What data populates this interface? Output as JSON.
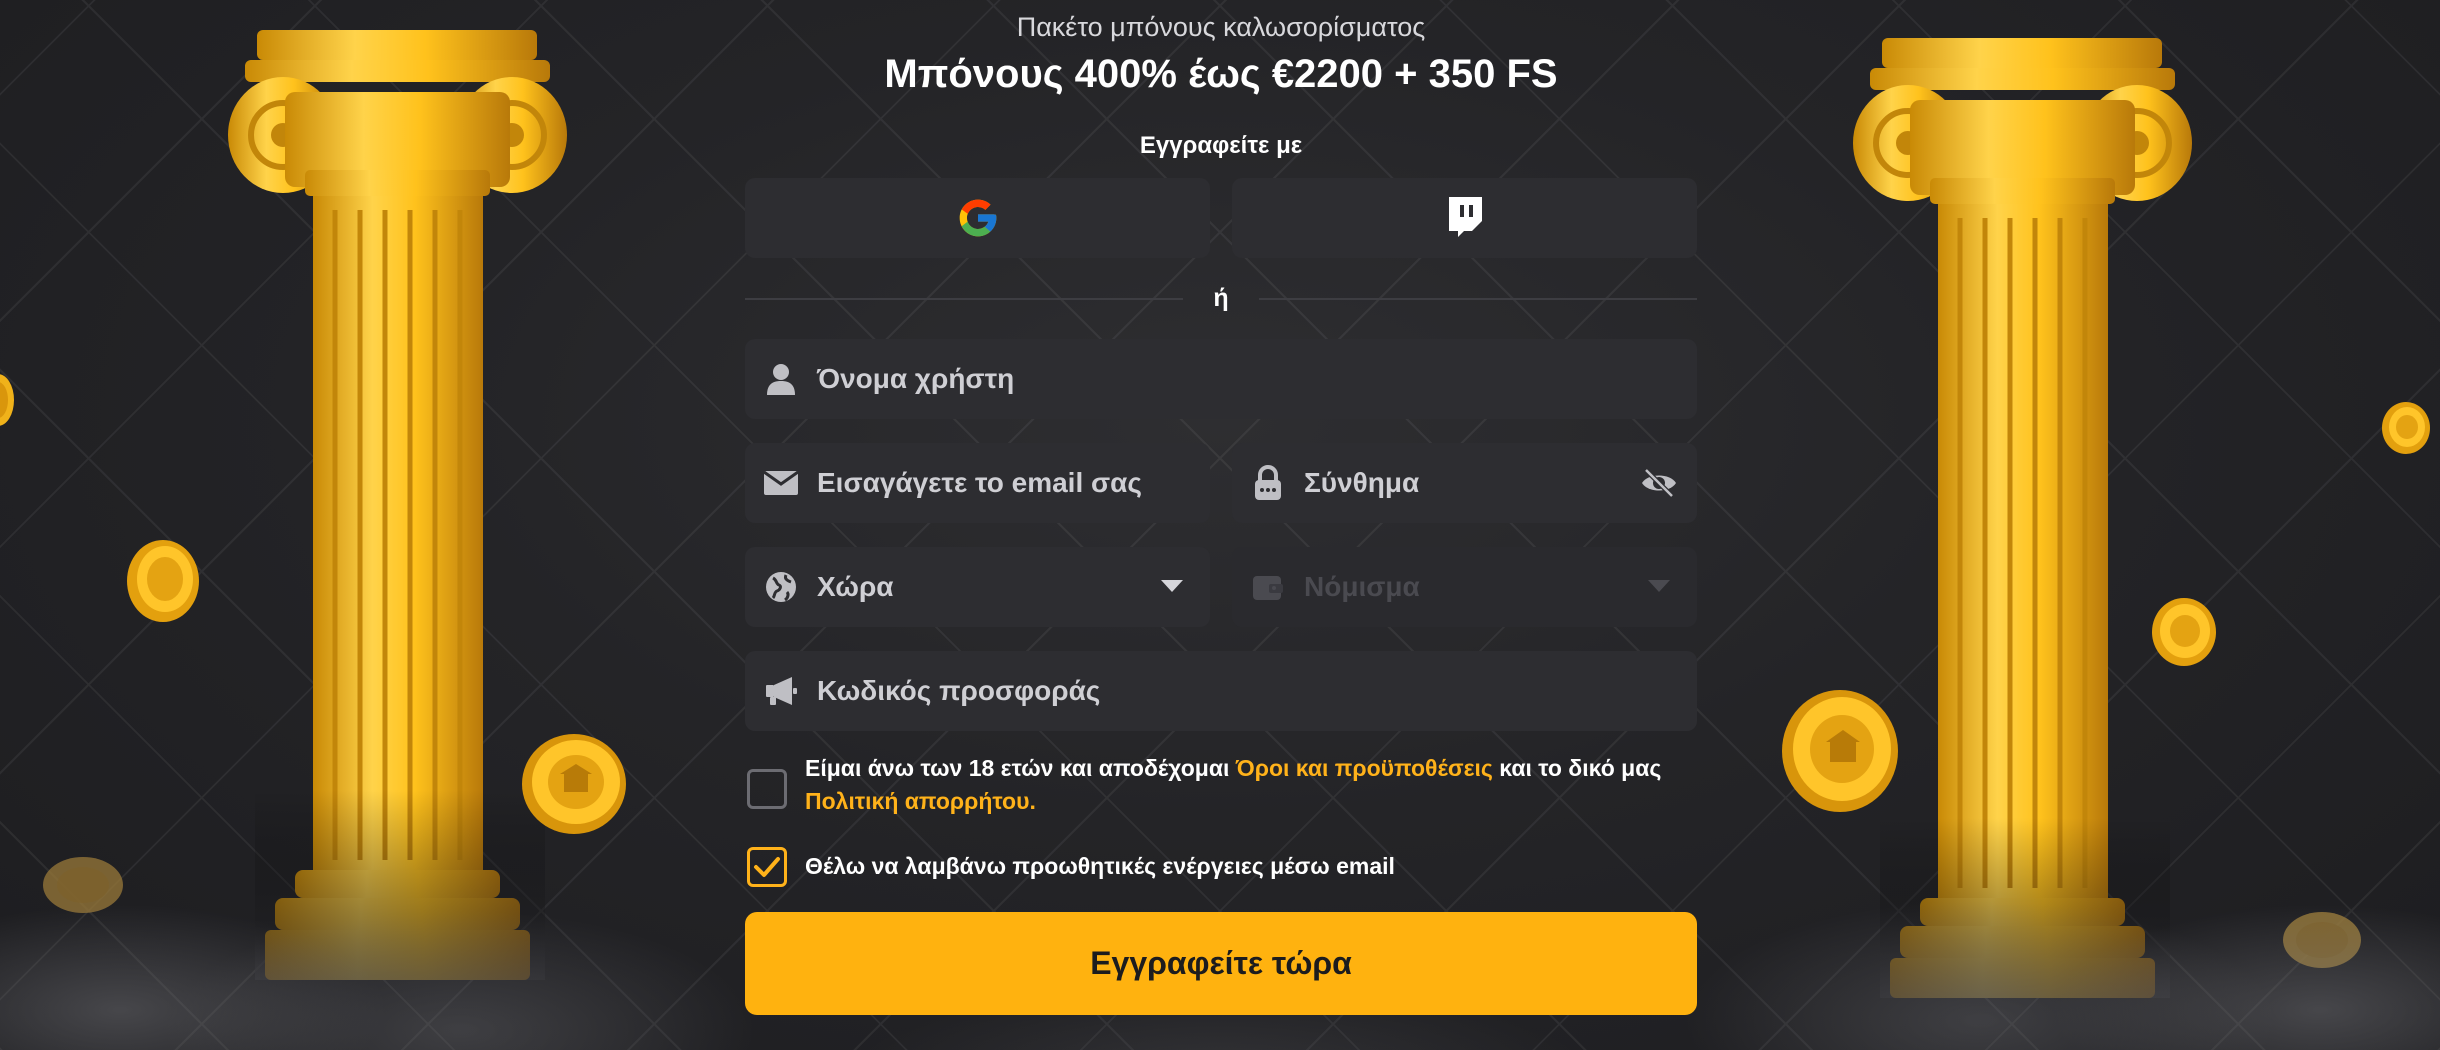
{
  "header": {
    "subtitle": "Πακέτο μπόνους καλωσορίσματος",
    "title": "Μπόνους 400% έως €2200 + 350 FS"
  },
  "social": {
    "heading": "Εγγραφείτε με",
    "providers": [
      "google-icon",
      "twitch-icon"
    ]
  },
  "divider": {
    "label": "ή"
  },
  "form": {
    "username": {
      "placeholder": "Όνομα χρήστη",
      "icon": "user-icon"
    },
    "email": {
      "placeholder": "Εισαγάγετε το email σας",
      "icon": "envelope-icon"
    },
    "password": {
      "placeholder": "Σύνθημα",
      "icon": "lock-icon",
      "toggle_icon": "eye-off-icon"
    },
    "country": {
      "placeholder": "Χώρα",
      "icon": "globe-icon"
    },
    "currency": {
      "placeholder": "Νόμισμα",
      "icon": "wallet-icon",
      "disabled": true
    },
    "promo": {
      "placeholder": "Κωδικός προσφοράς",
      "icon": "megaphone-icon"
    }
  },
  "consent": {
    "terms_prefix": "Είμαι άνω των 18 ετών και αποδέχομαι",
    "terms_link": "Όροι και προϋποθέσεις",
    "terms_middle": "και το δικό μας",
    "privacy_link": "Πολιτική απορρήτου.",
    "terms_checked": false,
    "promo_text": "Θέλω να λαμβάνω προωθητικές ενέργειες μέσω email",
    "promo_checked": true
  },
  "submit": {
    "label": "Εγγραφείτε τώρα"
  },
  "colors": {
    "accent": "#ffb20f",
    "field_bg": "#2d2d31",
    "background": "#242427"
  }
}
